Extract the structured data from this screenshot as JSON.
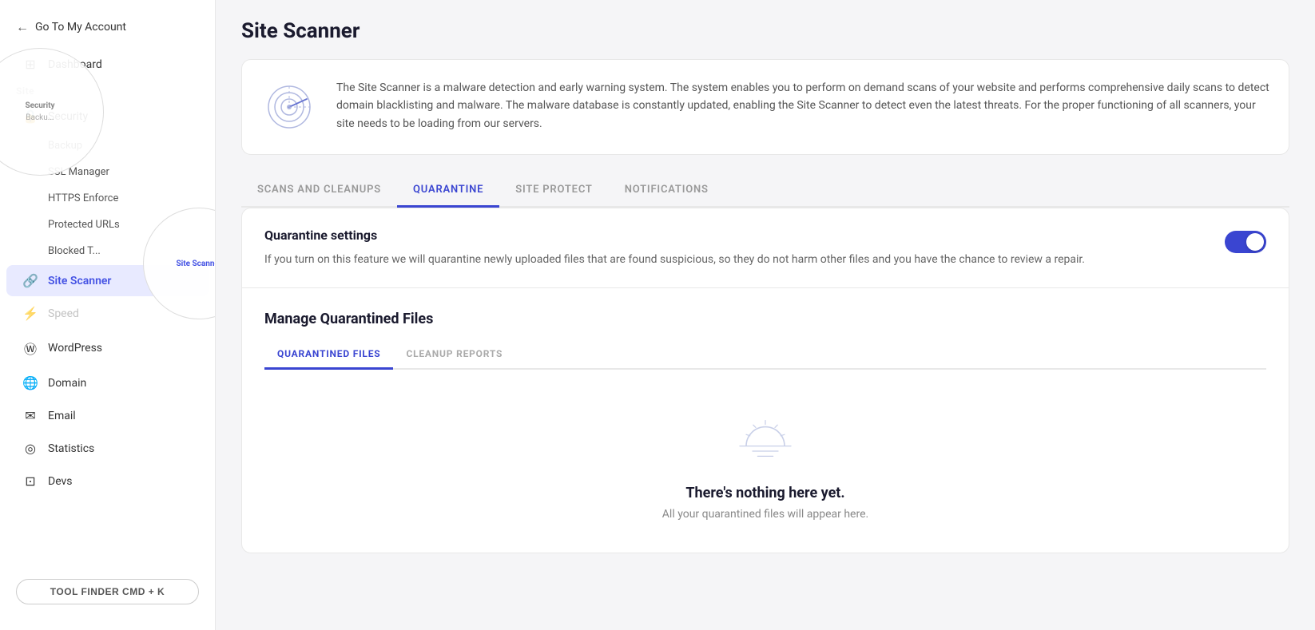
{
  "sidebar": {
    "back_label": "Go To My Account",
    "site_label": "Site",
    "dashboard_label": "Dashboard",
    "security_label": "Security",
    "security_sub": {
      "backup_label": "Backup",
      "ssl_manager_label": "SSL Manager",
      "https_enforce_label": "HTTPS Enforce",
      "protected_urls_label": "Protected URLs",
      "blocked_t_label": "Blocked T..."
    },
    "site_scanner_label": "Site Scanner",
    "speed_label": "Speed",
    "wordpress_label": "WordPress",
    "domain_label": "Domain",
    "email_label": "Email",
    "statistics_label": "Statistics",
    "devs_label": "Devs",
    "tool_finder_label": "TOOL FINDER CMD + K"
  },
  "page": {
    "title": "Site Scanner",
    "description": "The Site Scanner is a malware detection and early warning system. The system enables you to perform on demand scans of your website and performs comprehensive daily scans to detect domain blacklisting and malware. The malware database is constantly updated, enabling the Site Scanner to detect even the latest threats. For the proper functioning of all scanners, your site needs to be loading from our servers."
  },
  "tabs": [
    {
      "id": "scans",
      "label": "SCANS AND CLEANUPS"
    },
    {
      "id": "quarantine",
      "label": "QUARANTINE",
      "active": true
    },
    {
      "id": "site_protect",
      "label": "SITE PROTECT"
    },
    {
      "id": "notifications",
      "label": "NOTIFICATIONS"
    }
  ],
  "quarantine_settings": {
    "title": "Quarantine settings",
    "description": "If you turn on this feature we will quarantine newly uploaded files that are found suspicious, so they do not harm other files and you have the chance to review a repair.",
    "toggle_enabled": true
  },
  "manage_quarantined": {
    "title": "Manage Quarantined Files",
    "sub_tabs": [
      {
        "id": "quarantined_files",
        "label": "QUARANTINED FILES",
        "active": true
      },
      {
        "id": "cleanup_reports",
        "label": "CLEANUP REPORTS"
      }
    ],
    "empty_state": {
      "title": "There's nothing here yet.",
      "description": "All your quarantined files will appear here."
    }
  }
}
